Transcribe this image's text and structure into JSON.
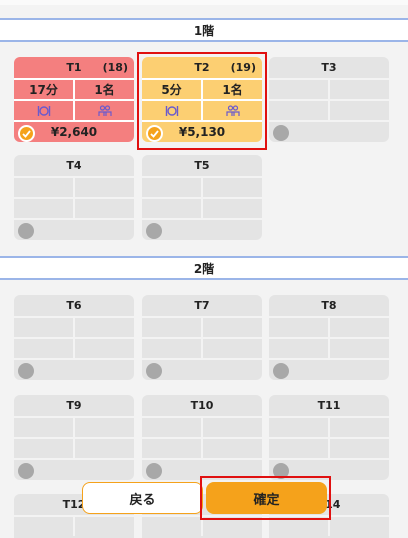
{
  "floors": [
    {
      "title": "1階"
    },
    {
      "title": "2階"
    }
  ],
  "tables": [
    {
      "name": "T1",
      "guests": "(18)",
      "time": "17分",
      "people": "1名",
      "amount": "¥2,640",
      "state": "red"
    },
    {
      "name": "T2",
      "guests": "(19)",
      "time": "5分",
      "people": "1名",
      "amount": "¥5,130",
      "state": "orange"
    },
    {
      "name": "T3"
    },
    {
      "name": "T4"
    },
    {
      "name": "T5"
    },
    {
      "name": "T6"
    },
    {
      "name": "T7"
    },
    {
      "name": "T8"
    },
    {
      "name": "T9"
    },
    {
      "name": "T10"
    },
    {
      "name": "T11"
    },
    {
      "name": "T12"
    },
    {
      "name": "T14"
    }
  ],
  "buttons": {
    "back": "戻る",
    "confirm": "確定"
  },
  "colors": {
    "occupied_red": "#f47f7f",
    "selected_orange": "#fccf72",
    "accent": "#f5a21b",
    "selection_frame": "#e01010",
    "floor_border": "#9bb5e8"
  },
  "icons": {
    "dining": "cutlery-icon",
    "people": "people-icon",
    "check": "check-icon"
  }
}
